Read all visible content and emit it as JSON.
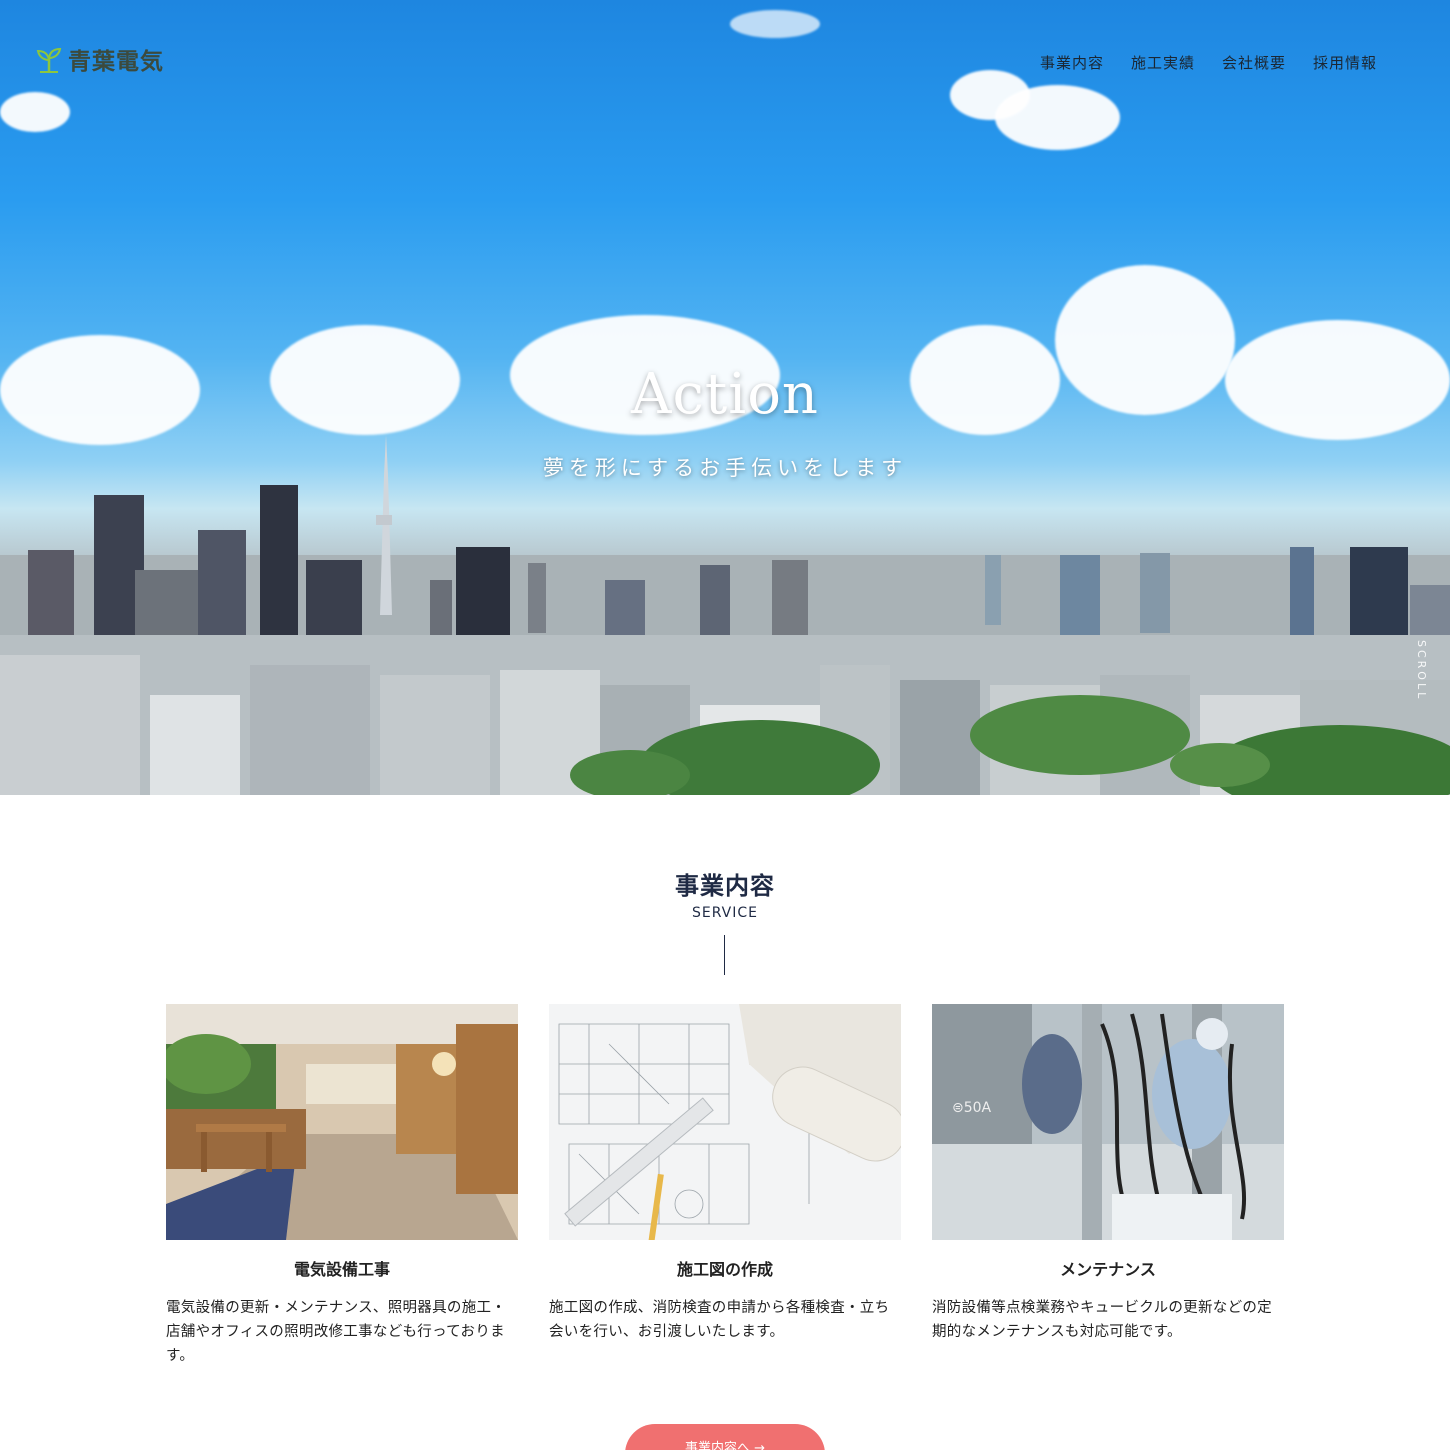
{
  "header": {
    "logo_text": "青葉電気",
    "nav": [
      "事業内容",
      "施工実績",
      "会社概要",
      "採用情報"
    ]
  },
  "hero": {
    "title": "Action",
    "subtitle": "夢を形にするお手伝いをします",
    "scroll_label": "SCROLL"
  },
  "service": {
    "title": "事業内容",
    "subtitle": "SERVICE",
    "cards": [
      {
        "title": "電気設備工事",
        "desc": "電気設備の更新・メンテナンス、照明器具の施工・店舗やオフィスの照明改修工事なども行っております。",
        "image": "office-interior"
      },
      {
        "title": "施工図の作成",
        "desc": "施工図の作成、消防検査の申請から各種検査・立ち会いを行い、お引渡しいたします。",
        "image": "blueprints"
      },
      {
        "title": "メンテナンス",
        "desc": "消防設備等点検業務やキュービクルの更新などの定期的なメンテナンスも対応可能です。",
        "image": "electrical-maintenance"
      }
    ],
    "more_button": "事業内容へ →"
  },
  "colors": {
    "navy": "#1f2a44",
    "accent": "#f07070",
    "logo_green": "#8cc63f"
  }
}
